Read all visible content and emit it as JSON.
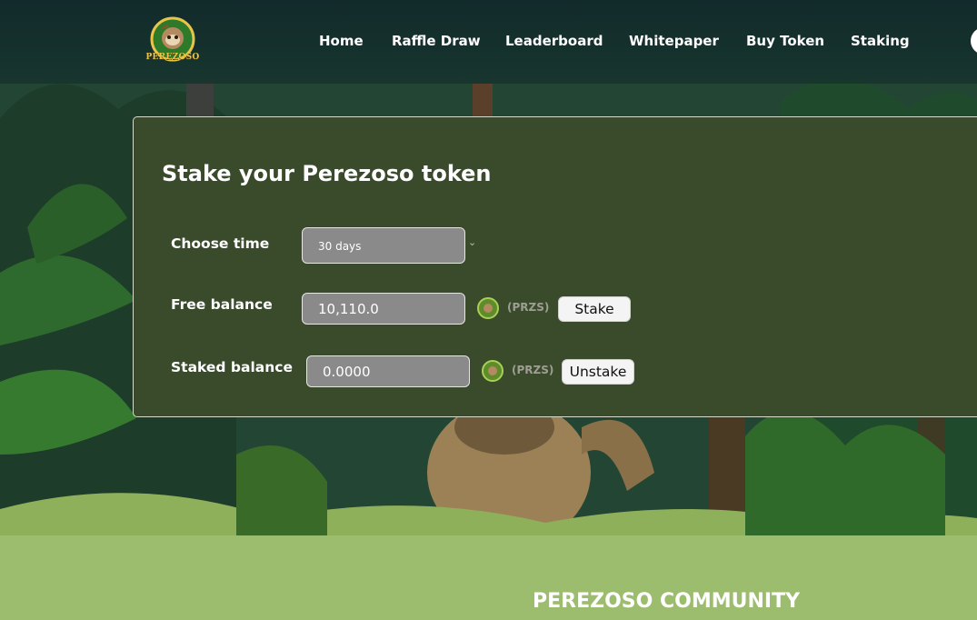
{
  "header": {
    "logo_text": "PEREZOSO",
    "nav": [
      {
        "label": "Home"
      },
      {
        "label": "Raffle Draw"
      },
      {
        "label": "Leaderboard"
      },
      {
        "label": "Whitepaper"
      },
      {
        "label": "Buy Token"
      },
      {
        "label": "Staking"
      }
    ]
  },
  "stake_card": {
    "title": "Stake your Perezoso token",
    "choose_time": {
      "label": "Choose time",
      "selected": "30 days"
    },
    "free_balance": {
      "label": "Free balance",
      "value": "10,110.0",
      "ticker": "(PRZS)",
      "button": "Stake"
    },
    "staked_balance": {
      "label": "Staked balance",
      "value": "0.0000",
      "ticker": "(PRZS)",
      "button": "Unstake"
    }
  },
  "community": {
    "title": "PEREZOSO COMMUNITY"
  },
  "colors": {
    "card_bg": "#3a4b2c",
    "community_bg": "#9cbc6e",
    "header_bg": "#14302c",
    "input_bg": "#8a8a8a",
    "logo_gold": "#e9c449"
  }
}
